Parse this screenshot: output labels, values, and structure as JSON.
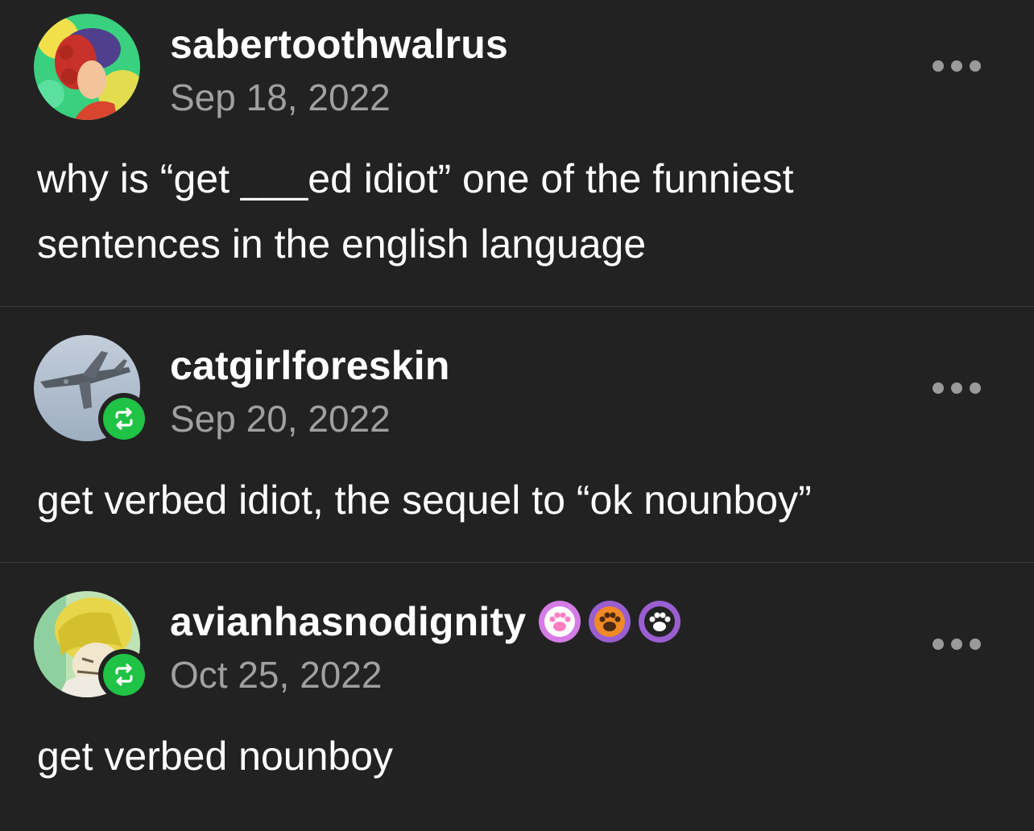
{
  "posts": [
    {
      "username": "sabertoothwalrus",
      "date": "Sep 18, 2022",
      "body_lines": [
        "why is “get ___ed idiot” one of the funniest",
        "sentences in the english language"
      ],
      "reblogged": false
    },
    {
      "username": "catgirlforeskin",
      "date": "Sep 20, 2022",
      "body_lines": [
        "get verbed idiot, the sequel to “ok nounboy”"
      ],
      "reblogged": true
    },
    {
      "username": "avianhasnodignity",
      "date": "Oct 25, 2022",
      "body_lines": [
        "get verbed nounboy"
      ],
      "reblogged": true,
      "badges": [
        "paw-badge-pink",
        "paw-badge-orange",
        "paw-badge-purple"
      ]
    }
  ],
  "icons": {
    "more": "more-options-icon",
    "reblog": "reblog-icon",
    "badge": "paw-badge-icon"
  },
  "colors": {
    "background": "#222222",
    "divider": "#3c3c3c",
    "reblog_green": "#1fc345",
    "date_gray": "#a0a0a0"
  }
}
